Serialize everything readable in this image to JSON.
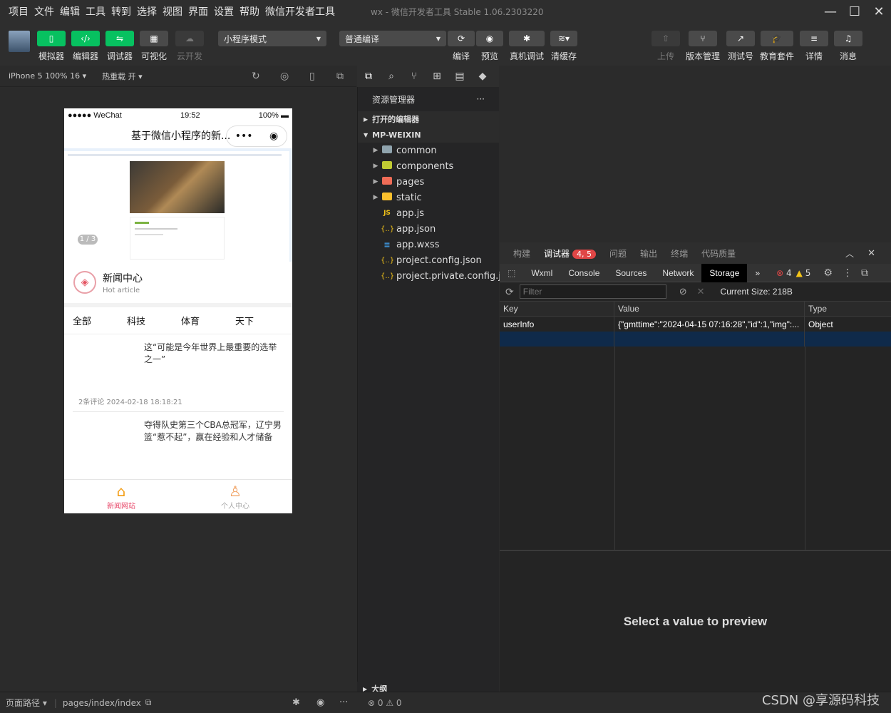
{
  "menu": {
    "items": [
      "项目",
      "文件",
      "编辑",
      "工具",
      "转到",
      "选择",
      "视图",
      "界面",
      "设置",
      "帮助",
      "微信开发者工具"
    ]
  },
  "window": {
    "title": "wx - 微信开发者工具 Stable 1.06.2303220"
  },
  "toolbar": {
    "simulator": "模拟器",
    "editor": "编辑器",
    "debugger": "调试器",
    "visual": "可视化",
    "cloud": "云开发",
    "mode_select": "小程序模式",
    "compile_select": "普通编译",
    "compile": "编译",
    "preview": "预览",
    "remote_debug": "真机调试",
    "clear_cache": "清缓存",
    "upload": "上传",
    "version": "版本管理",
    "test_account": "测试号",
    "edu": "教育套件",
    "details": "详情",
    "messages": "消息"
  },
  "sim_bar": {
    "device": "iPhone 5 100% 16",
    "hot_reload": "热重载 开"
  },
  "phone": {
    "carrier": "●●●●● WeChat",
    "time": "19:52",
    "battery": "100%",
    "nav_title": "基于微信小程序的新...",
    "banner_indicator": "1 / 3",
    "news_title": "新闻中心",
    "news_subtitle": "Hot article",
    "tabs": [
      "全部",
      "科技",
      "体育",
      "天下"
    ],
    "articles": [
      {
        "title": "这“可能是今年世界上最重要的选举之一”",
        "meta": "2条评论   2024-02-18 18:18:21"
      },
      {
        "title": "夺得队史第三个CBA总冠军，辽宁男篮“惹不起”，赢在经验和人才储备",
        "meta": ""
      }
    ],
    "tabbar": {
      "home": "新闻网站",
      "profile": "个人中心"
    }
  },
  "explorer": {
    "header": "资源管理器",
    "more": "···",
    "open_editors": "打开的编辑器",
    "project": "MP-WEIXIN",
    "folders": [
      {
        "name": "common",
        "color": "#90a4ae"
      },
      {
        "name": "components",
        "color": "#c0ca33"
      },
      {
        "name": "pages",
        "color": "#ef6c57"
      },
      {
        "name": "static",
        "color": "#fbc02d"
      }
    ],
    "files": [
      {
        "name": "app.js",
        "icon": "JS"
      },
      {
        "name": "app.json",
        "icon": "{..}"
      },
      {
        "name": "app.wxss",
        "icon": "≡"
      },
      {
        "name": "project.config.json",
        "icon": "{..}"
      },
      {
        "name": "project.private.config.js...",
        "icon": "{..}"
      }
    ],
    "outline": "大纲"
  },
  "debugger": {
    "tabs": [
      "构建",
      "调试器",
      "问题",
      "输出",
      "终端",
      "代码质量"
    ],
    "badge": "4, 5",
    "devtools_tabs": [
      "Wxml",
      "Console",
      "Sources",
      "Network",
      "Storage"
    ],
    "errors": "4",
    "warnings": "5",
    "filter_placeholder": "Filter",
    "current_size": "Current Size: 218B",
    "columns": [
      "Key",
      "Value",
      "Type"
    ],
    "rows": [
      {
        "key": "userInfo",
        "value": "{\"gmttime\":\"2024-04-15 07:16:28\",\"id\":1,\"img\":...",
        "type": "Object"
      }
    ],
    "preview_text": "Select a value to preview"
  },
  "statusbar": {
    "page_path_label": "页面路径",
    "page_path": "pages/index/index",
    "problems": "⊗ 0 ⚠ 0"
  },
  "watermark": "CSDN @享源码科技"
}
